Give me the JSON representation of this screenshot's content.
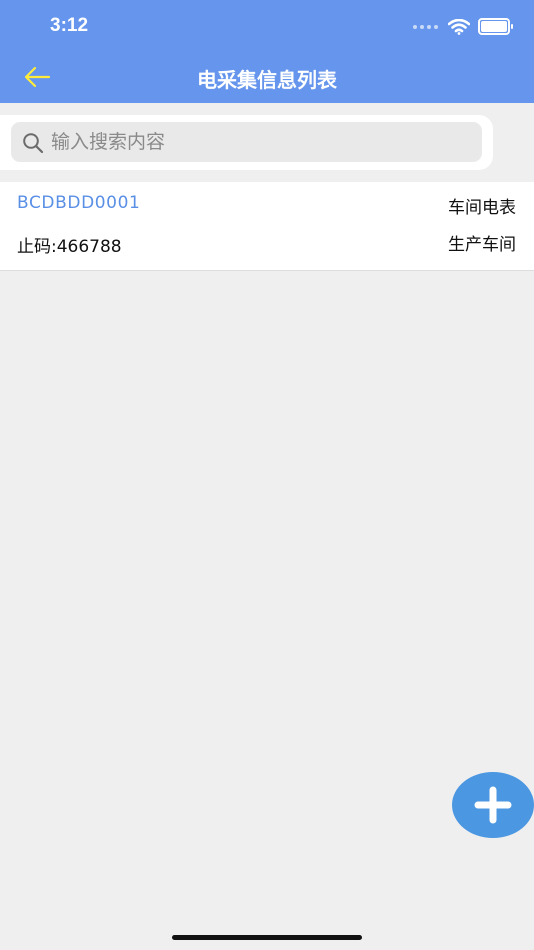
{
  "status_bar": {
    "time": "3:12"
  },
  "nav": {
    "title": "电采集信息列表",
    "back_icon": "arrow-left-icon"
  },
  "search": {
    "placeholder": "输入搜索内容",
    "value": ""
  },
  "items": [
    {
      "code": "BCDBDD0001",
      "meter_name": "车间电表",
      "reading": "止码:466788",
      "workshop": "生产车间"
    }
  ],
  "fab": {
    "icon": "plus-icon"
  },
  "colors": {
    "header": "#6595ec",
    "back_arrow": "#ffeb3b",
    "code_text": "#5a8fe6",
    "fab": "#4b97e1",
    "background": "#efefef"
  }
}
